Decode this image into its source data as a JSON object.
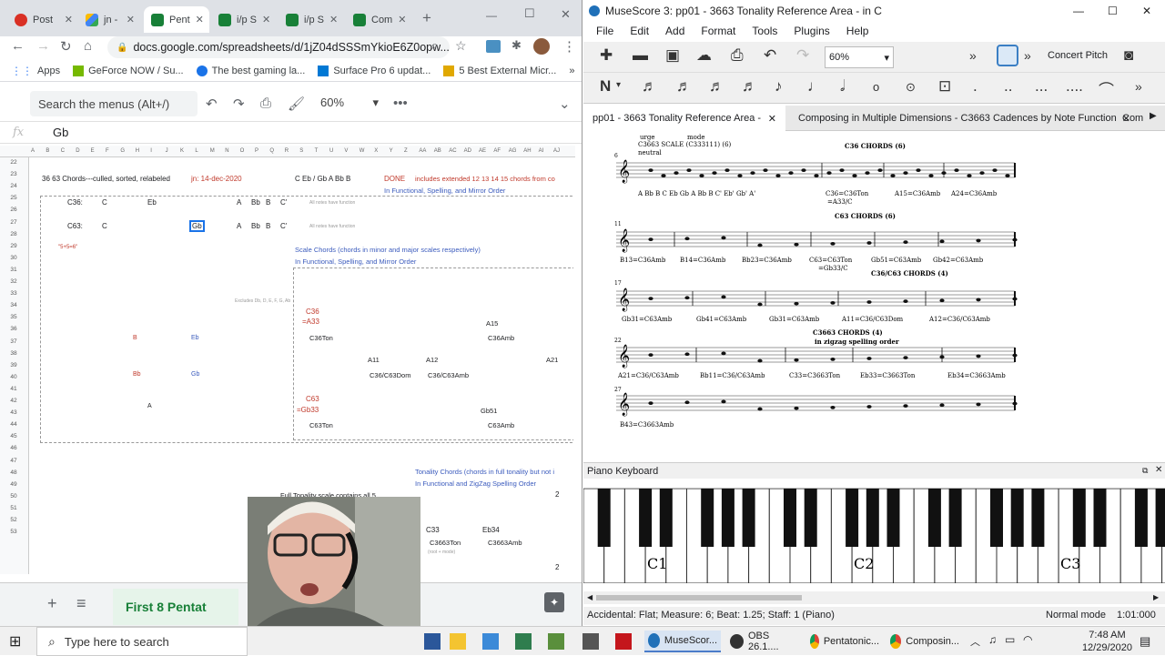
{
  "chrome": {
    "tabs": [
      {
        "label": "Post",
        "color": "#d93025",
        "icon": "post-favicon"
      },
      {
        "label": "jn -",
        "color": "#4285f4",
        "icon": "drive-favicon"
      },
      {
        "label": "Pent",
        "color": "#188038",
        "icon": "sheets-favicon"
      },
      {
        "label": "i/p S",
        "color": "#188038",
        "icon": "sheets-favicon"
      },
      {
        "label": "i/p S",
        "color": "#188038",
        "icon": "sheets-favicon"
      },
      {
        "label": "Com",
        "color": "#188038",
        "icon": "sheets-favicon"
      }
    ],
    "new_tab": "+",
    "url": "docs.google.com/spreadsheets/d/1jZ04dSSSmYkioE6Z0opw...",
    "bookmarks": [
      {
        "label": "Apps",
        "icon": "apps-grid-icon"
      },
      {
        "label": "GeForce NOW / Su...",
        "icon": "geforce-icon"
      },
      {
        "label": "The best gaming la...",
        "icon": "globe-icon"
      },
      {
        "label": "Surface Pro 6 updat...",
        "icon": "windows-icon"
      },
      {
        "label": "5 Best External Micr...",
        "icon": "site-icon"
      }
    ],
    "bookmarks_more": "»"
  },
  "sheets": {
    "menu_search": "Search the menus (Alt+/)",
    "zoom": "60%",
    "formula_value": "Gb",
    "fx": "fx",
    "columns": [
      "A",
      "B",
      "C",
      "D",
      "E",
      "F",
      "G",
      "H",
      "I",
      "J",
      "K",
      "L",
      "M",
      "N",
      "O",
      "P",
      "Q",
      "R",
      "S",
      "T",
      "U",
      "V",
      "W",
      "X",
      "Y",
      "Z",
      "AA",
      "AB",
      "AC",
      "AD",
      "AE",
      "AF",
      "AG",
      "AH",
      "AI",
      "AJ"
    ],
    "rows": [
      "22",
      "23",
      "24",
      "25",
      "26",
      "27",
      "28",
      "29",
      "30",
      "31",
      "32",
      "33",
      "34",
      "35",
      "36",
      "37",
      "38",
      "39",
      "40",
      "41",
      "42",
      "43",
      "44",
      "45",
      "46",
      "47",
      "48",
      "49",
      "50",
      "51",
      "52",
      "53"
    ],
    "cells": {
      "r23_title": "36 63 Chords---culled, sorted, relabeled",
      "r23_date": "jn: 14-dec-2020",
      "r23_scale": "C Eb / Gb A Bb B",
      "r23_done": "DONE",
      "r23_note": "includes extended 12 13 14 15 chords from co",
      "r24_func": "In Functional, Spelling, and Mirror Order",
      "c36": "C36:",
      "c63": "C63:",
      "C": "C",
      "Eb": "Eb",
      "Gb": "Gb",
      "A": "A",
      "Bb": "Bb",
      "B": "B",
      "Cp": "C'",
      "allnotes": "All notes have function",
      "ratio": "\"5+5=6\"",
      "scale_chords": "Scale Chords (chords in minor and major scales respectively)",
      "func2": "In Functional, Spelling, and Mirror Order",
      "excludes": "Excludes Db, D, E, F, G, Ab",
      "c36lbl": "C36",
      "a33": "=A33",
      "c36ton": "C36Ton",
      "a15": "A15",
      "c36amb": "C36Amb",
      "a11": "A11",
      "a12": "A12",
      "a21": "A21",
      "c36c63dom": "C36/C63Dom",
      "c36c63amb": "C36/C63Amb",
      "c63lbl": "C63",
      "gb33": "=Gb33",
      "gb51": "Gb51",
      "c63ton": "C63Ton",
      "c63amb": "C63Amb",
      "tonality": "Tonality Chords (chords in full tonality but not i",
      "zigzag": "In Functional and ZigZag Spelling Order",
      "fullscale": "Full Tonality scale contains all 5",
      "c33": "C33",
      "eb34": "Eb34",
      "c3663ton": "C3663Ton",
      "c3663amb": "C3663Amb",
      "two": "2",
      "small": "(root + mode)"
    },
    "sheet_tab": "First 8 Pentat",
    "add_sheet": "+",
    "all_sheets": "≡"
  },
  "musescore": {
    "title": "MuseScore 3: pp01 - 3663 Tonality Reference Area - in C",
    "menu": [
      "File",
      "Edit",
      "Add",
      "Format",
      "Tools",
      "Plugins",
      "Help"
    ],
    "zoom": "60%",
    "concert_pitch": "Concert Pitch",
    "tabs": [
      "pp01 - 3663 Tonality Reference Area - in C",
      "Composing in Multiple Dimensions - C3663 Cadences by Note Function",
      "Com"
    ],
    "score": {
      "top_labels": [
        "urge",
        "mode",
        "C3663 SCALE (C333111) (6)",
        "neutral"
      ],
      "scale_notes": "A  Bb  B   C  Eb Gb  A   Bb    B  C' Eb' Gb' A'",
      "sys1_header": "C36 CHORDS (6)",
      "sys1_chords": [
        "C36=C36Ton",
        "A15=C36Amb",
        "A24=C36Amb"
      ],
      "sys1_sub": "=A33/C",
      "sys2_header": "C63 CHORDS (6)",
      "sys2_chords": [
        "B13=C36Amb",
        "B14=C36Amb",
        "Bb23=C36Amb",
        "C63=C63Ton",
        "Gb51=C63Amb",
        "Gb42=C63Amb"
      ],
      "sys2_sub": "=Gb33/C",
      "sys3_header": "C36/C63 CHORDS (4)",
      "sys3_chords": [
        "Gb31=C63Amb",
        "Gb41=C63Amb",
        "Gb31=C63Amb",
        "A11=C36/C63Dom",
        "A12=C36/C63Amb"
      ],
      "sys4_header": "C3663 CHORDS (4)",
      "sys4_sub": "in zigzag spelling order",
      "sys4_chords": [
        "A21=C36/C63Amb",
        "Bb11=C36/C63Amb",
        "C33=C3663Ton",
        "Eb33=C3663Ton",
        "Eb34=C3663Amb"
      ],
      "sys5_chords": [
        "B43=C3663Amb"
      ],
      "measure_numbers": [
        "6",
        "11",
        "17",
        "22",
        "27"
      ]
    },
    "piano_keyboard": "Piano Keyboard",
    "octaves": [
      "C1",
      "C2",
      "C3"
    ],
    "status": "Accidental: Flat; Measure: 6; Beat: 1.25; Staff: 1 (Piano)",
    "mode": "Normal mode",
    "time": "1:01:000"
  },
  "taskbar": {
    "search": "Type here to search",
    "apps": [
      {
        "label": "MuseScor...",
        "icon": "musescore-icon"
      },
      {
        "label": "OBS 26.1....",
        "icon": "obs-icon"
      },
      {
        "label": "Pentatonic...",
        "icon": "chrome-icon"
      },
      {
        "label": "Composin...",
        "icon": "chrome-icon"
      }
    ],
    "time": "7:48 AM",
    "date": "12/29/2020"
  }
}
